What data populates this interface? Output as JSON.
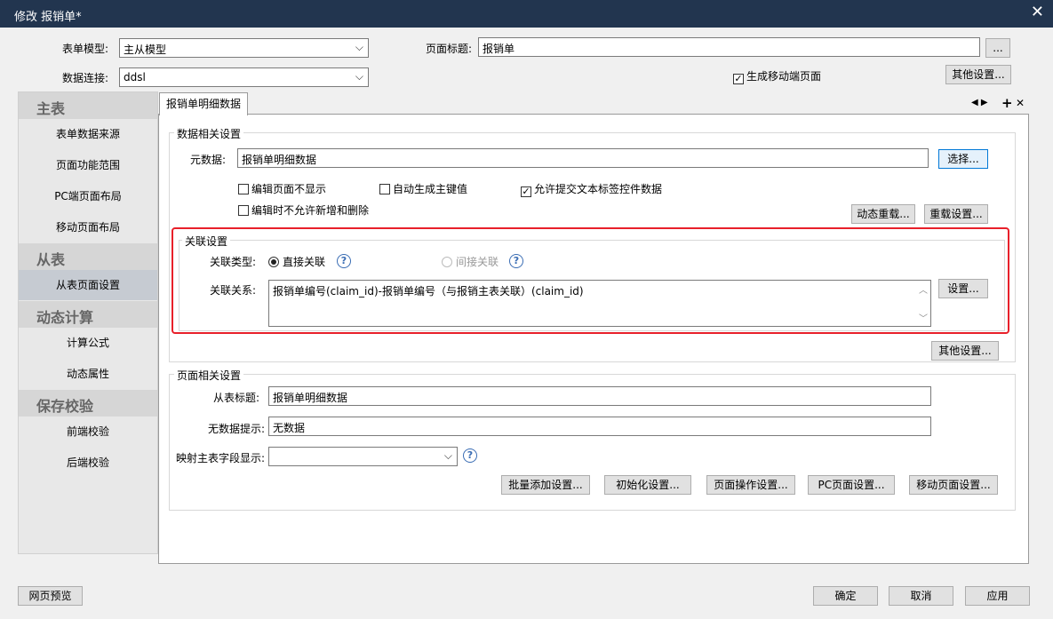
{
  "window": {
    "title": "修改 报销单*"
  },
  "form": {
    "model_label": "表单模型:",
    "model_value": "主从模型",
    "conn_label": "数据连接:",
    "conn_value": "ddsl",
    "page_title_label": "页面标题:",
    "page_title_value": "报销单",
    "ellipsis": "...",
    "mobile_label": "生成移动端页面",
    "other_settings": "其他设置..."
  },
  "sidebar": {
    "sections": [
      {
        "title": "主表",
        "items": [
          "表单数据来源",
          "页面功能范围",
          "PC端页面布局",
          "移动页面布局"
        ]
      },
      {
        "title": "从表",
        "items": [
          "从表页面设置"
        ]
      },
      {
        "title": "动态计算",
        "items": [
          "计算公式",
          "动态属性"
        ]
      },
      {
        "title": "保存校验",
        "items": [
          "前端校验",
          "后端校验"
        ]
      }
    ]
  },
  "tab": {
    "label": "报销单明细数据",
    "nav": "◀ ▶",
    "add": "+",
    "close": "✕"
  },
  "data_group": {
    "title": "数据相关设置",
    "meta_label": "元数据:",
    "meta_value": "报销单明细数据",
    "select_btn": "选择...",
    "cb1": "编辑页面不显示",
    "cb2": "自动生成主键值",
    "cb3": "允许提交文本标签控件数据",
    "cb4": "编辑时不允许新增和删除",
    "dyn_reload": "动态重载...",
    "reload_settings": "重载设置..."
  },
  "assoc_group": {
    "title": "关联设置",
    "type_label": "关联类型:",
    "direct": "直接关联",
    "indirect": "间接关联",
    "rel_label": "关联关系:",
    "rel_value": "报销单编号(claim_id)-报销单编号（与报销主表关联）(claim_id)",
    "settings_btn": "设置...",
    "other_btn": "其他设置..."
  },
  "page_group": {
    "title": "页面相关设置",
    "sub_title_label": "从表标题:",
    "sub_title_value": "报销单明细数据",
    "nodata_label": "无数据提示:",
    "nodata_value": "无数据",
    "map_label": "映射主表字段显示:",
    "buttons": [
      "批量添加设置...",
      "初始化设置...",
      "页面操作设置...",
      "PC页面设置...",
      "移动页面设置..."
    ]
  },
  "footer": {
    "preview": "网页预览",
    "ok": "确定",
    "cancel": "取消",
    "apply": "应用"
  }
}
